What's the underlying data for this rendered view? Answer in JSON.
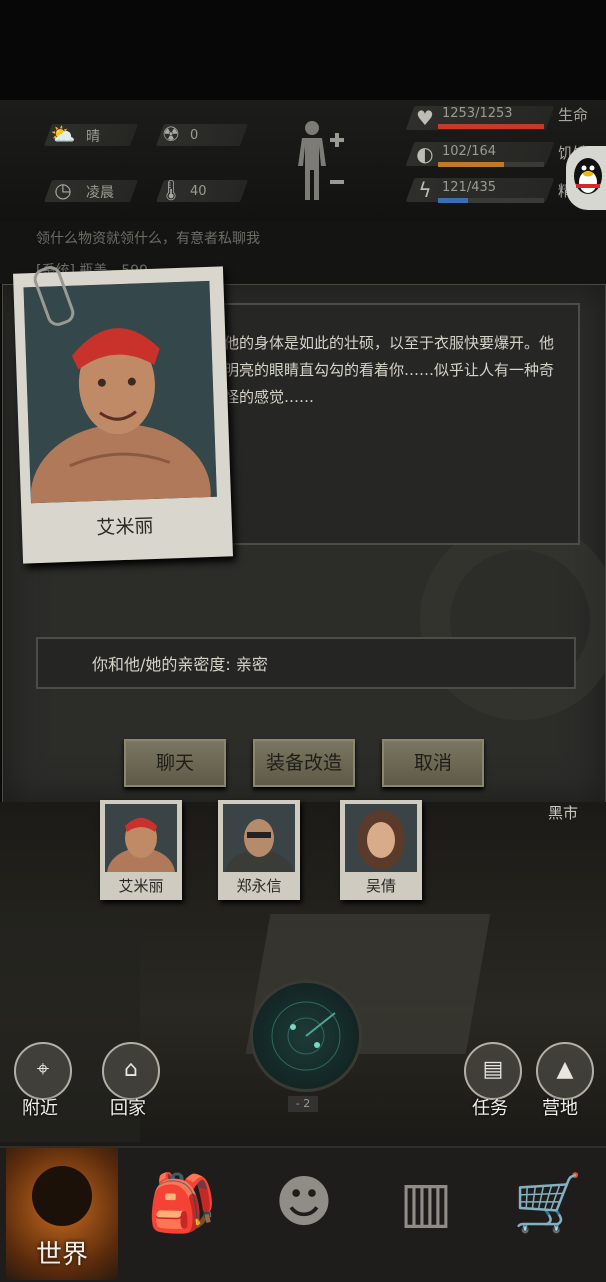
{
  "status": {
    "weather": "晴",
    "radiation": "0",
    "time_of_day": "凌晨",
    "temperature": "40",
    "hp": {
      "value": "1253/1253",
      "label": "生命",
      "fraction": 1.0,
      "color": "#c23b2b"
    },
    "hunger": {
      "value": "102/164",
      "label": "饥饿",
      "fraction": 0.62,
      "color": "#c07a24"
    },
    "energy": {
      "value": "121/435",
      "label": "精力",
      "fraction": 0.28,
      "color": "#3a6fb5"
    }
  },
  "chat": {
    "line1": "领什么物资就领什么，有意者私聊我",
    "line2": "[系统] 瓶盖 - 599"
  },
  "dialog": {
    "character_name": "艾米丽",
    "description": "他的身体是如此的壮硕，以至于衣服快要爆开。他明亮的眼睛直勾勾的看着你……似乎让人有一种奇怪的感觉……",
    "affinity": "你和他/她的亲密度: 亲密",
    "buttons": {
      "chat": "聊天",
      "equip": "装备改造",
      "cancel": "取消"
    }
  },
  "scene": {
    "market_label": "黑市",
    "npcs": [
      "艾米丽",
      "郑永信",
      "吴倩"
    ],
    "radar_level": "- 2",
    "left_buttons": [
      {
        "label": "附近",
        "icon": "location-icon"
      },
      {
        "label": "回家",
        "icon": "home-icon"
      }
    ],
    "right_buttons": [
      {
        "label": "任务",
        "icon": "task-icon"
      },
      {
        "label": "营地",
        "icon": "tent-icon"
      }
    ]
  },
  "nav": {
    "world": "世界",
    "items": [
      "backpack-icon",
      "skills-head-icon",
      "radio-icon",
      "cart-icon"
    ]
  }
}
